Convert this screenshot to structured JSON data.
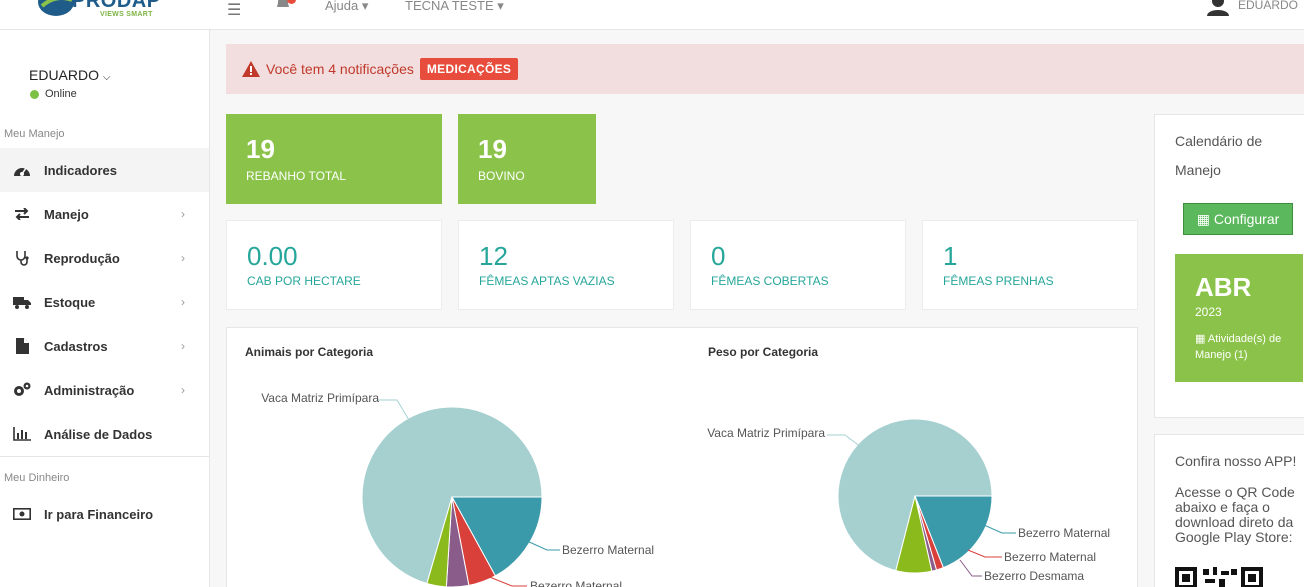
{
  "topbar": {
    "logo_text": "PRODAP",
    "logo_sub": "VIEWS SMART",
    "help": "Ajuda",
    "farm": "TECNA TESTE",
    "user": "EDUARDO"
  },
  "sidebar": {
    "user": "EDUARDO",
    "status": "Online",
    "section1": "Meu Manejo",
    "items": [
      {
        "label": "Indicadores",
        "icon": "dashboard-icon"
      },
      {
        "label": "Manejo",
        "icon": "exchange-icon"
      },
      {
        "label": "Reprodução",
        "icon": "stethoscope-icon"
      },
      {
        "label": "Estoque",
        "icon": "truck-icon"
      },
      {
        "label": "Cadastros",
        "icon": "file-icon"
      },
      {
        "label": "Administração",
        "icon": "cogs-icon"
      },
      {
        "label": "Análise de Dados",
        "icon": "bar-chart-icon"
      }
    ],
    "section2": "Meu Dinheiro",
    "finance": "Ir para Financeiro"
  },
  "alert": {
    "text": "Você tem 4 notificações",
    "badge": "MEDICAÇÕES",
    "color": "#c0392b"
  },
  "stats_green": [
    {
      "value": "19",
      "label": "REBANHO TOTAL"
    },
    {
      "value": "19",
      "label": "BOVINO"
    }
  ],
  "stats_white": [
    {
      "value": "0.00",
      "label": "CAB POR HECTARE"
    },
    {
      "value": "12",
      "label": "FÊMEAS APTAS VAZIAS"
    },
    {
      "value": "0",
      "label": "FÊMEAS COBERTAS"
    },
    {
      "value": "1",
      "label": "FÊMEAS PRENHAS"
    }
  ],
  "charts": {
    "left_title": "Animais por Categoria",
    "right_title": "Peso por Categoria"
  },
  "chart_data": [
    {
      "type": "pie",
      "title": "Animais por Categoria",
      "labels": [
        "Vaca Matriz Primípara",
        "Bezerro Maternal",
        "Bezerro Maternal",
        "",
        ""
      ],
      "values": [
        70.5,
        17,
        5,
        4,
        3.5
      ],
      "colors": [
        "#a6d0d0",
        "#3a9aaa",
        "#d9403a",
        "#8a5c8a",
        "#8bba1c"
      ]
    },
    {
      "type": "pie",
      "title": "Peso por Categoria",
      "labels": [
        "Vaca Matriz Primípara",
        "Bezerro Maternal",
        "Bezerro Maternal",
        "Bezerro Desmama",
        ""
      ],
      "values": [
        71,
        19,
        1.5,
        1,
        7.5
      ],
      "colors": [
        "#a6d0d0",
        "#3a9aaa",
        "#d9403a",
        "#8a5c8a",
        "#8bba1c"
      ]
    }
  ],
  "calendar": {
    "title": "Calendário de Manejo",
    "button": "Configurar",
    "month": "ABR",
    "year": "2023",
    "activities": "Atividade(s) de Manejo (1)"
  },
  "app": {
    "title": "Confira nosso APP!",
    "text": "Acesse o QR Code abaixo e faça o download direto da Google Play Store:"
  }
}
